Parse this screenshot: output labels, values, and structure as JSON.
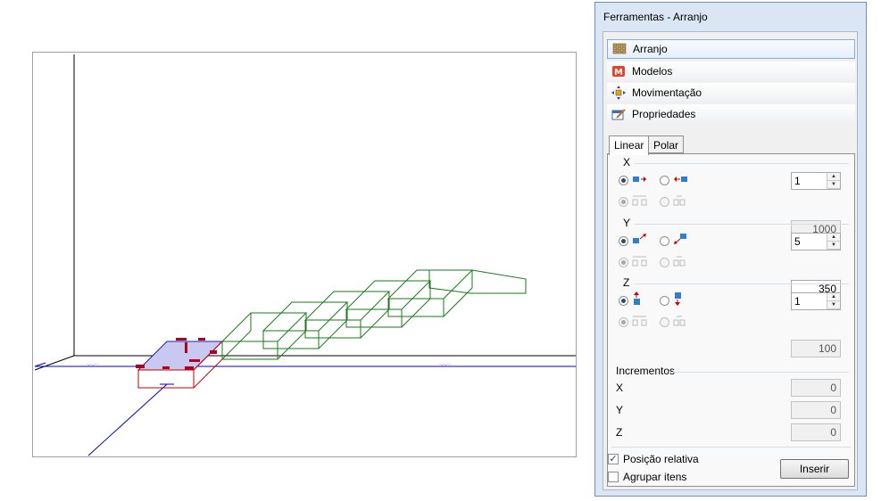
{
  "window_title": "Ferramentas - Arranjo",
  "sections": [
    {
      "label": "Arranjo",
      "icon": "arrangement-grid-icon"
    },
    {
      "label": "Modelos",
      "icon": "models-m-icon"
    },
    {
      "label": "Movimentação",
      "icon": "move-arrows-icon"
    },
    {
      "label": "Propriedades",
      "icon": "properties-edit-icon"
    }
  ],
  "tabs": [
    "Linear",
    "Polar"
  ],
  "axes": [
    {
      "name": "X",
      "count": "1",
      "spacing": "1000",
      "spacing_enabled": false
    },
    {
      "name": "Y",
      "count": "5",
      "spacing": "350",
      "spacing_enabled": true
    },
    {
      "name": "Z",
      "count": "1",
      "spacing": "100",
      "spacing_enabled": false
    }
  ],
  "increments": {
    "label": "Incrementos",
    "fields": [
      {
        "name": "X",
        "value": "0"
      },
      {
        "name": "Y",
        "value": "0"
      },
      {
        "name": "Z",
        "value": "0"
      }
    ]
  },
  "options": {
    "relative_position": {
      "label": "Posição relativa",
      "checked": true
    },
    "group_items": {
      "label": "Agrupar itens",
      "checked": false
    }
  },
  "insert_label": "Inserir",
  "colors": {
    "wireframe": "#1a7a1a",
    "axis": "#0000cc",
    "selection": "#c8c8f0",
    "handles": "#cc0000"
  }
}
